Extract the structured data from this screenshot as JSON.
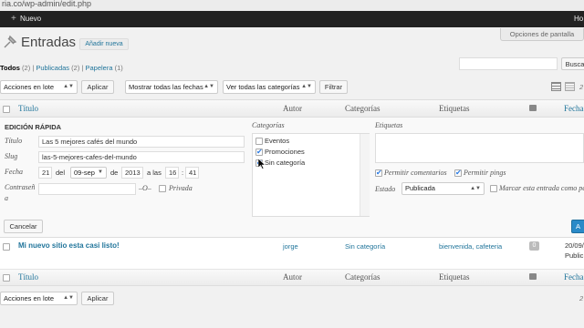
{
  "browser": {
    "url": "ria.co/wp-admin/edit.php"
  },
  "adminbar": {
    "new_label": "Nuevo",
    "right_text": "Ho"
  },
  "header": {
    "title": "Entradas",
    "add_new": "Añadir nueva",
    "screen_options": "Opciones de pantalla"
  },
  "subsubsub": {
    "all": "Todos",
    "all_count": "(2)",
    "published": "Publicadas",
    "published_count": "(2)",
    "trash": "Papelera",
    "trash_count": "(1)",
    "sep": "|"
  },
  "search": {
    "button": "Busca"
  },
  "filters": {
    "bulk_select": "Acciones en lote",
    "apply": "Aplicar",
    "dates_select": "Mostrar todas las fechas",
    "categories_select": "Ver todas las categorías",
    "filter": "Filtrar",
    "view_icons": [
      "list-view-icon",
      "excerpt-view-icon"
    ],
    "count_partial": "2"
  },
  "columns": {
    "title": "Título",
    "author": "Autor",
    "categories": "Categorías",
    "tags": "Etiquetas",
    "comments_icon": "comment-bubble-icon",
    "date": "Fecha"
  },
  "quick_edit": {
    "heading": "EDICIÓN RÁPIDA",
    "title_label": "Título",
    "title_value": "Las 5 mejores cafés del mundo",
    "slug_label": "Slug",
    "slug_value": "las-5-mejores-cafes-del-mundo",
    "date_label": "Fecha",
    "day": "21",
    "del": "del",
    "month": "09-sep",
    "de": "de",
    "year": "2013",
    "at": "a las",
    "hour": "16",
    "colon": ":",
    "minute": "41",
    "password_label": "Contraseñ",
    "password_label_2": "a",
    "or": "–O–",
    "private": "Privada",
    "categories_label": "Categorías",
    "categories": [
      {
        "name": "Eventos",
        "checked": false
      },
      {
        "name": "Promociones",
        "checked": true
      },
      {
        "name": "Sin categoría",
        "checked": true
      }
    ],
    "tags_label": "Etiquetas",
    "allow_comments": "Permitir comentarios",
    "allow_pings": "Permitir pings",
    "status_label": "Estado",
    "status_value": "Publicada",
    "sticky": "Marcar esta entrada como pe",
    "cancel": "Cancelar",
    "update_partial": "A"
  },
  "rows": [
    {
      "title": "Mi nuevo sitio esta casi listo!",
      "author": "jorge",
      "category": "Sin categoría",
      "tags": "bienvenida, cafeteria",
      "comments": "0",
      "date": "20/09/",
      "date_status": "Public"
    }
  ],
  "footer": {
    "bulk_select": "Acciones en lote",
    "apply": "Aplicar",
    "count_partial": "2"
  }
}
